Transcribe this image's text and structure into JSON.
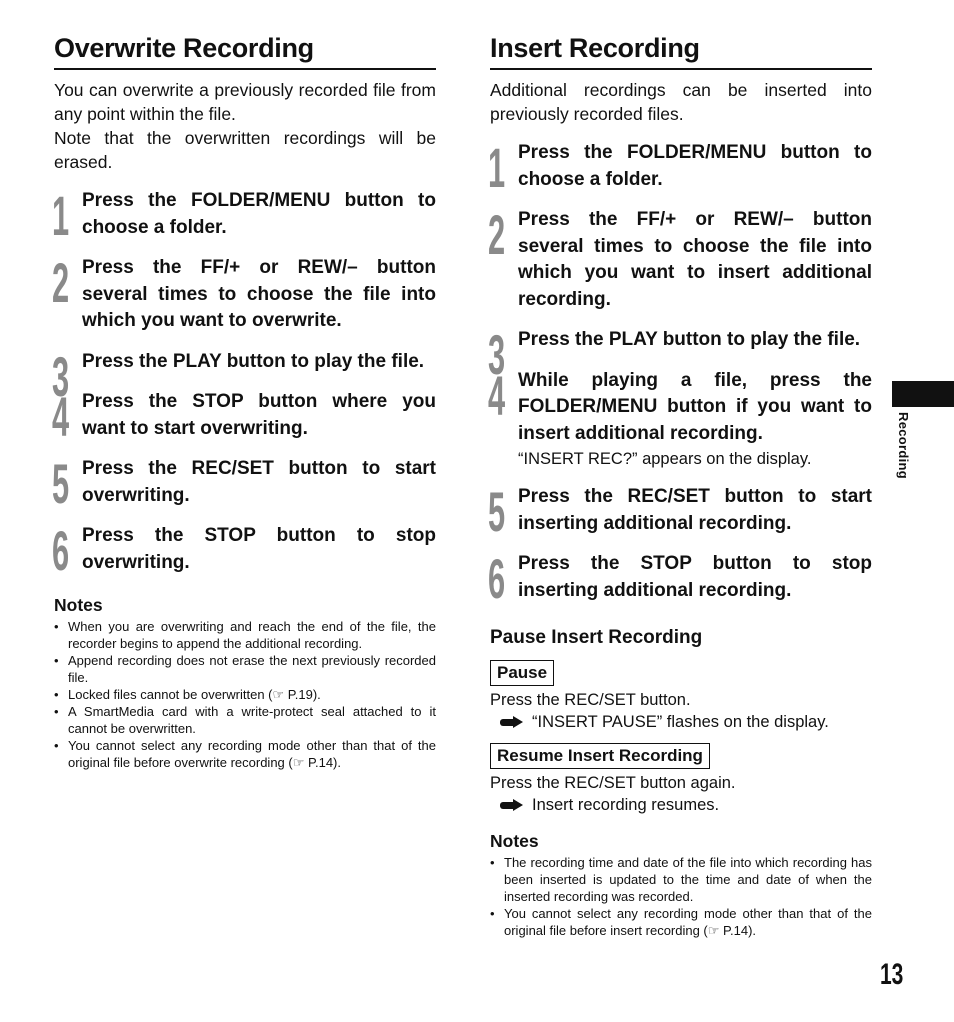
{
  "left": {
    "title": "Overwrite Recording",
    "intro": [
      "You can overwrite a previously recorded file from any point within the file.",
      "Note that the overwritten recordings will be erased."
    ],
    "steps": [
      {
        "num": "1",
        "text": "Press the FOLDER/MENU button to choose a folder."
      },
      {
        "num": "2",
        "text": "Press the FF/+ or REW/– button several times to choose the file into which you want to overwrite."
      },
      {
        "num": "3",
        "text": "Press the PLAY button to play the file."
      },
      {
        "num": "4",
        "text": "Press the STOP button where you want to start overwriting."
      },
      {
        "num": "5",
        "text": "Press the REC/SET button to start overwriting."
      },
      {
        "num": "6",
        "text": "Press the STOP button to stop overwriting."
      }
    ],
    "notes_title": "Notes",
    "notes": [
      "When you are overwriting and reach the end of the file, the recorder begins to append the additional recording.",
      "Append recording does not erase the next previously recorded file.",
      "Locked files cannot be overwritten (☞ P.19).",
      "A SmartMedia card with a write-protect seal attached to it cannot be overwritten.",
      "You cannot select any recording mode other than that of the original file before overwrite recording (☞ P.14)."
    ]
  },
  "right": {
    "title": "Insert Recording",
    "intro": [
      "Additional recordings can be inserted into previously recorded files."
    ],
    "steps": [
      {
        "num": "1",
        "text": "Press the FOLDER/MENU button to choose a folder."
      },
      {
        "num": "2",
        "text": "Press the FF/+ or REW/– button several times to choose the file into which you want to insert additional recording."
      },
      {
        "num": "3",
        "text": "Press the PLAY button to play the file."
      },
      {
        "num": "4",
        "text": "While playing a file, press the FOLDER/MENU button if you want to insert additional recording.",
        "sub": "“INSERT REC?” appears on the display."
      },
      {
        "num": "5",
        "text": "Press the REC/SET button to start inserting additional recording."
      },
      {
        "num": "6",
        "text": "Press the STOP button to stop inserting additional recording."
      }
    ],
    "pause_section": {
      "title": "Pause Insert Recording",
      "pause": {
        "label": "Pause",
        "instruction": "Press the REC/SET button.",
        "result": "“INSERT PAUSE” flashes on the display."
      },
      "resume": {
        "label": "Resume Insert Recording",
        "instruction": "Press the REC/SET button again.",
        "result": "Insert recording resumes."
      }
    },
    "notes_title": "Notes",
    "notes": [
      "The recording time and date of the file into which recording has been inserted is updated to the time and date of when the inserted recording was recorded.",
      "You cannot select any recording mode other than that of the original file before insert recording (☞ P.14)."
    ]
  },
  "side_tab": {
    "label": "Recording"
  },
  "page_number": "13"
}
